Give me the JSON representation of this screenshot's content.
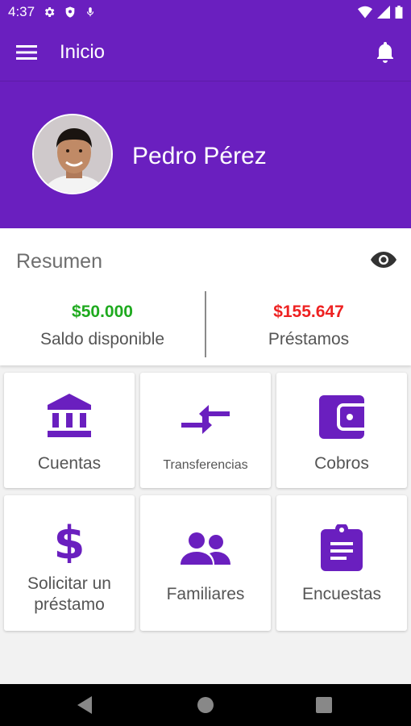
{
  "status_bar": {
    "time": "4:37"
  },
  "app_bar": {
    "title": "Inicio",
    "menu_icon": "menu-icon",
    "notification_icon": "bell-icon"
  },
  "profile": {
    "name": "Pedro Pérez"
  },
  "summary": {
    "title": "Resumen",
    "visibility_icon": "eye-icon",
    "balance": {
      "amount": "$50.000",
      "label": "Saldo disponible",
      "color": "#1faa1f"
    },
    "loans": {
      "amount": "$155.647",
      "label": "Préstamos",
      "color": "#ee2222"
    }
  },
  "tiles": [
    {
      "label": "Cuentas",
      "icon": "bank-icon"
    },
    {
      "label": "Transferencias",
      "icon": "transfer-arrows-icon"
    },
    {
      "label": "Cobros",
      "icon": "wallet-icon"
    },
    {
      "label": "Solicitar un préstamo",
      "icon": "dollar-icon"
    },
    {
      "label": "Familiares",
      "icon": "people-icon"
    },
    {
      "label": "Encuestas",
      "icon": "clipboard-icon"
    }
  ],
  "colors": {
    "primary": "#6a1fbf",
    "accent": "#6a1fbf"
  }
}
